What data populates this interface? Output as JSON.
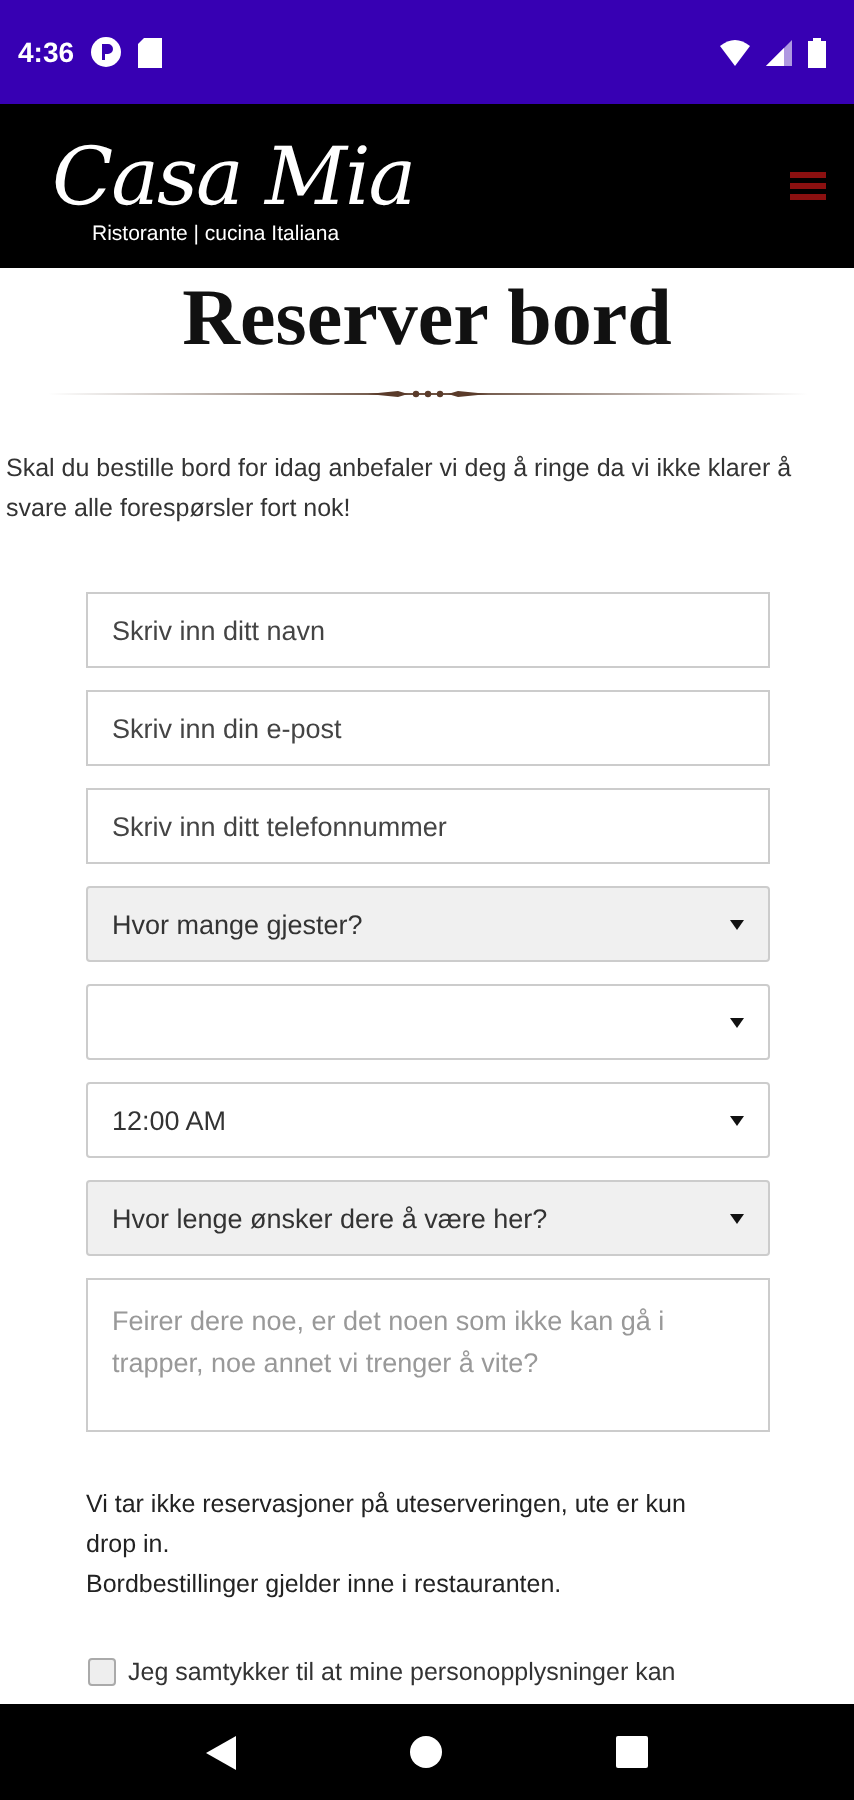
{
  "status_bar": {
    "time": "4:36"
  },
  "header": {
    "logo": "Casa Mia",
    "tagline": "Ristorante | cucina Italiana"
  },
  "page": {
    "title": "Reserver bord",
    "intro": "Skal du bestille bord for idag anbefaler vi deg å ringe da vi ikke klarer å svare alle forespørsler fort nok!"
  },
  "form": {
    "fields": [
      {
        "kind": "input",
        "placeholder": "Skriv inn ditt navn"
      },
      {
        "kind": "input",
        "placeholder": "Skriv inn din e-post"
      },
      {
        "kind": "input",
        "placeholder": "Skriv inn ditt telefonnummer"
      },
      {
        "kind": "select",
        "value": "Hvor mange gjester?",
        "shaded": true
      },
      {
        "kind": "select",
        "shaded": false
      },
      {
        "kind": "select",
        "value": "12:00 AM",
        "shaded": false
      },
      {
        "kind": "select",
        "value": "Hvor lenge ønsker dere å være her?",
        "shaded": true
      },
      {
        "kind": "textarea",
        "placeholder": "Feirer dere noe, er det noen som ikke kan gå i trapper, noe annet vi trenger å vite?"
      }
    ],
    "notes": [
      "Vi tar ikke reservasjoner på uteserveringen, ute er kun drop in.",
      "Bordbestillinger gjelder inne i restauranten."
    ],
    "consent": {
      "label": "Jeg samtykker til at mine personopplysninger kan",
      "checked": false
    }
  }
}
